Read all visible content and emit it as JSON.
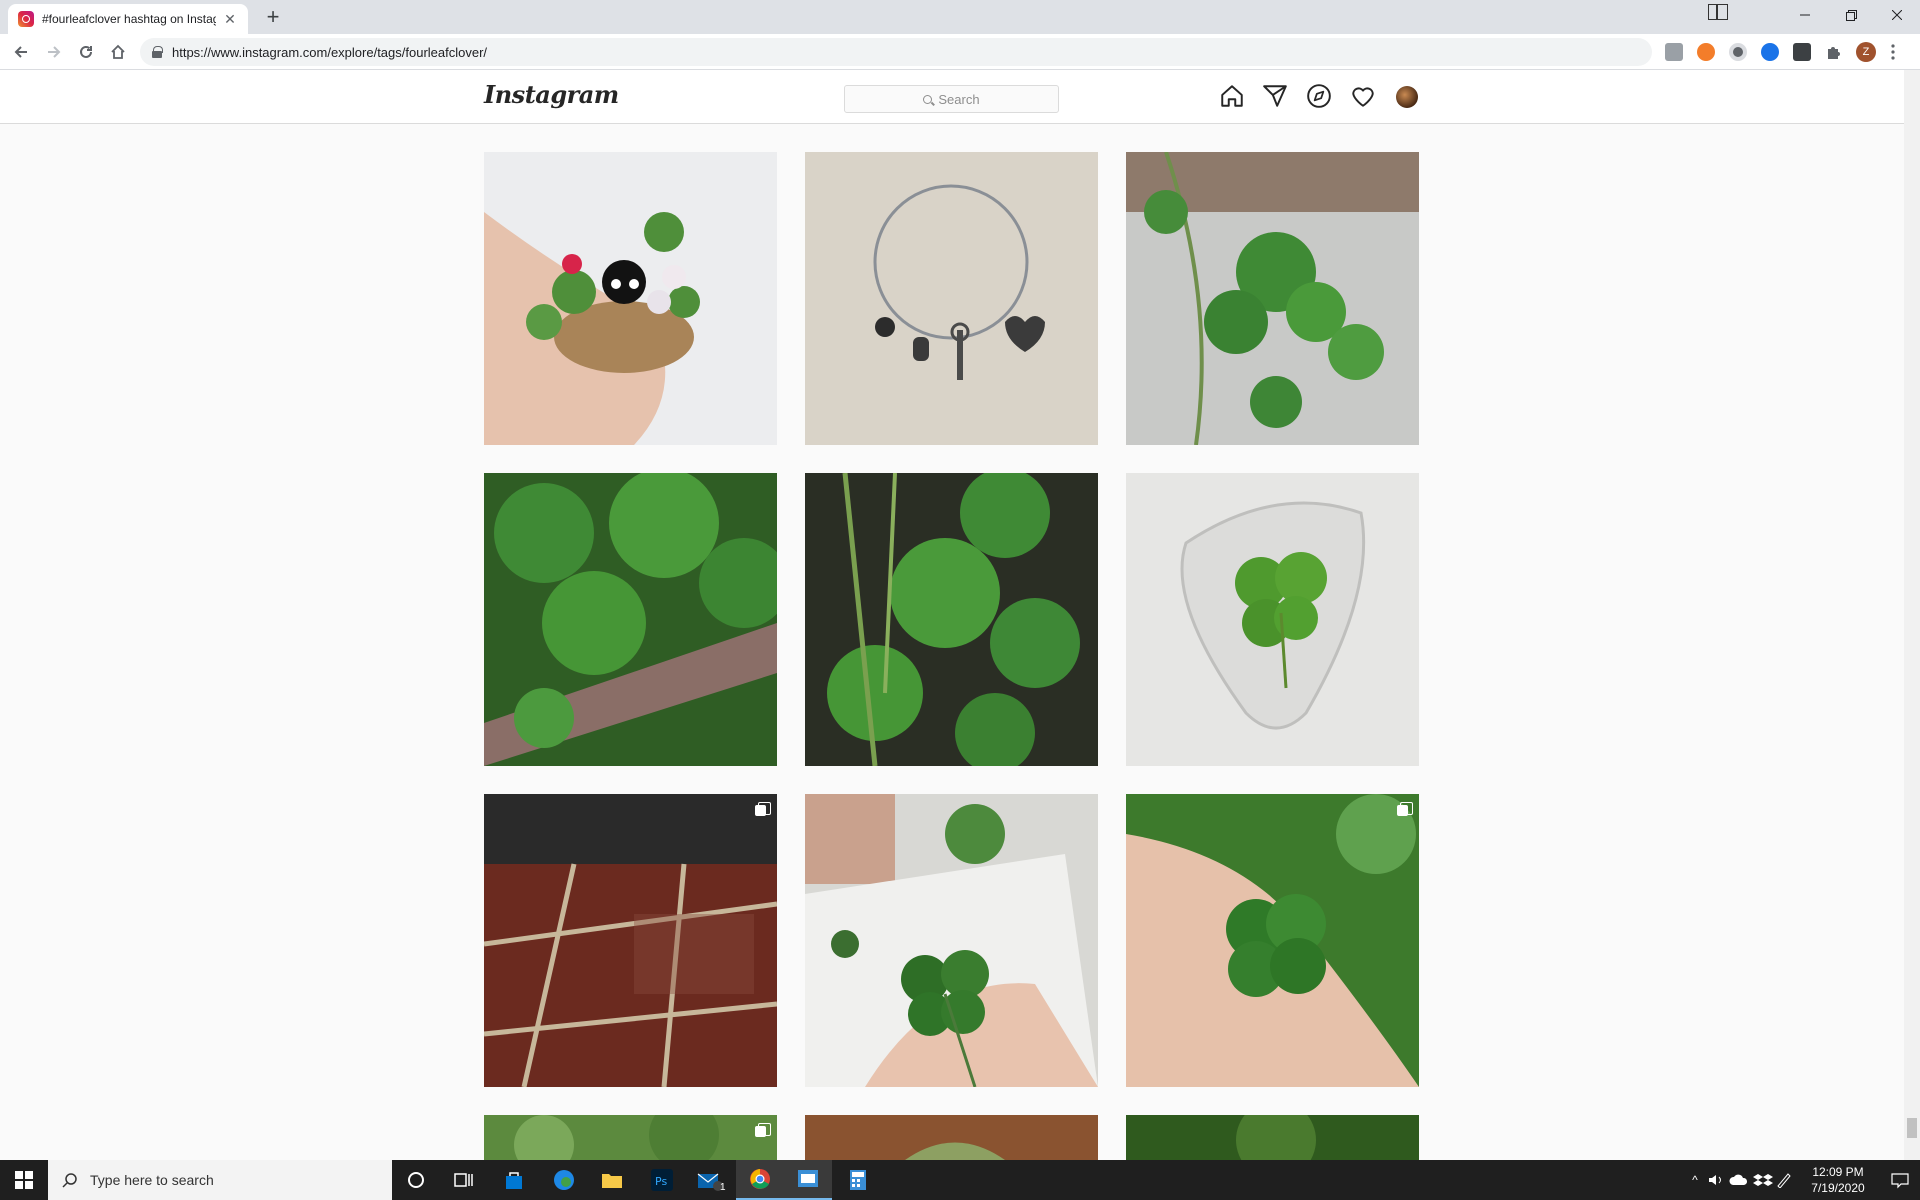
{
  "browser": {
    "tab_title": "#fourleafclover hashtag on Instagram",
    "new_tab": "+",
    "url": "https://www.instagram.com/explore/tags/fourleafclover/",
    "profile_initial": "Z"
  },
  "instagram": {
    "logo": "Instagram",
    "search_placeholder": "Search",
    "nav_icons": [
      "home-icon",
      "direct-message-icon",
      "explore-icon",
      "activity-heart-icon",
      "profile-avatar"
    ]
  },
  "posts": [
    {
      "subject": "crochet basket with cat and clovers",
      "multi": false
    },
    {
      "subject": "silver bangle with charms",
      "multi": false
    },
    {
      "subject": "clover plant on stone",
      "multi": false
    },
    {
      "subject": "clover patch on planter edge",
      "multi": false
    },
    {
      "subject": "clover patch with grass",
      "multi": false
    },
    {
      "subject": "four leaf clover in resin guitar pick",
      "multi": false
    },
    {
      "subject": "red floor tiles",
      "multi": true
    },
    {
      "subject": "four leaf clover over book",
      "multi": false
    },
    {
      "subject": "four leaf clover in hand",
      "multi": true
    },
    {
      "subject": "green leaves",
      "multi": true
    },
    {
      "subject": "leaf on wooden table",
      "multi": false
    },
    {
      "subject": "green foliage",
      "multi": false
    }
  ],
  "taskbar": {
    "search_placeholder": "Type here to search",
    "mail_badge": "1",
    "time": "12:09 PM",
    "date": "7/19/2020"
  },
  "colors": {
    "ig_background": "#fafafa",
    "ig_border": "#dbdbdb",
    "taskbar": "#1f1f1f",
    "clover_green": "#3f8a35"
  }
}
